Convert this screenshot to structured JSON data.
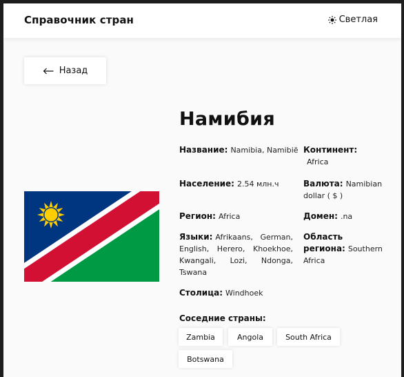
{
  "header": {
    "title": "Справочник стран",
    "theme_label": "Светлая",
    "theme_icon": "sun-icon"
  },
  "back": {
    "label": "Назад",
    "icon": "arrow-left-icon"
  },
  "country": {
    "name": "Намибия",
    "native_name": {
      "label": "Название:",
      "value": "Namibia, Namibië"
    },
    "continent": {
      "label": "Континент:",
      "value": "Africa"
    },
    "population": {
      "label": "Население:",
      "value": "2.54 млн.ч"
    },
    "currency": {
      "label": "Валюта:",
      "value": "Namibian dollar ( $ )"
    },
    "region": {
      "label": "Регион:",
      "value": "Africa"
    },
    "domain": {
      "label": "Домен:",
      "value": ".na"
    },
    "languages": {
      "label": "Языки:",
      "value": "Afrikaans, German, English, Herero, Khoekhoe, Kwangali, Lozi, Ndonga, Tswana"
    },
    "subregion": {
      "label": "Область региона:",
      "value": "Southern Africa"
    },
    "capital": {
      "label": "Столица:",
      "value": "Windhoek"
    }
  },
  "neighbors": {
    "label": "Соседние страны:",
    "items": [
      "Zambia",
      "Angola",
      "South Africa",
      "Botswana"
    ]
  },
  "colors": {
    "flag_blue": "#003580",
    "flag_red": "#D21034",
    "flag_green": "#009A44",
    "flag_sun": "#FFCE00"
  }
}
